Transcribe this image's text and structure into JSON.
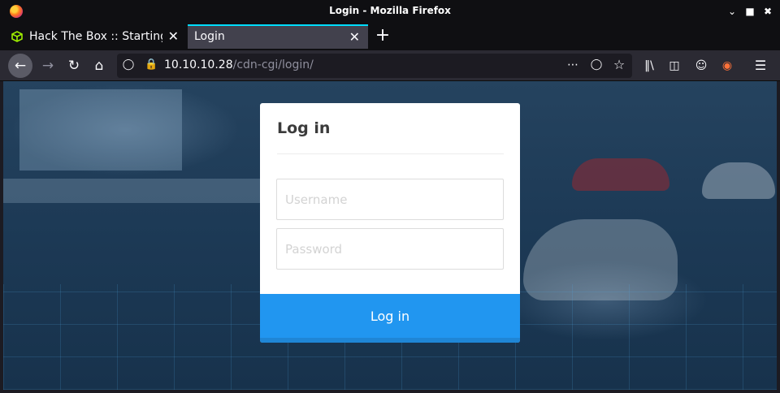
{
  "window": {
    "title": "Login - Mozilla Firefox"
  },
  "tabs": [
    {
      "label": "Hack The Box :: Starting P",
      "icon": "htb-cube-icon",
      "active": false
    },
    {
      "label": "Login",
      "active": true
    }
  ],
  "navbar": {
    "url_host": "10.10.10.28",
    "url_path": "/cdn-cgi/login/"
  },
  "login": {
    "heading": "Log in",
    "username_placeholder": "Username",
    "password_placeholder": "Password",
    "submit_label": "Log in"
  },
  "colors": {
    "accent_tab": "#00ddff",
    "button": "#2196f0",
    "htb_green": "#9fef00"
  }
}
